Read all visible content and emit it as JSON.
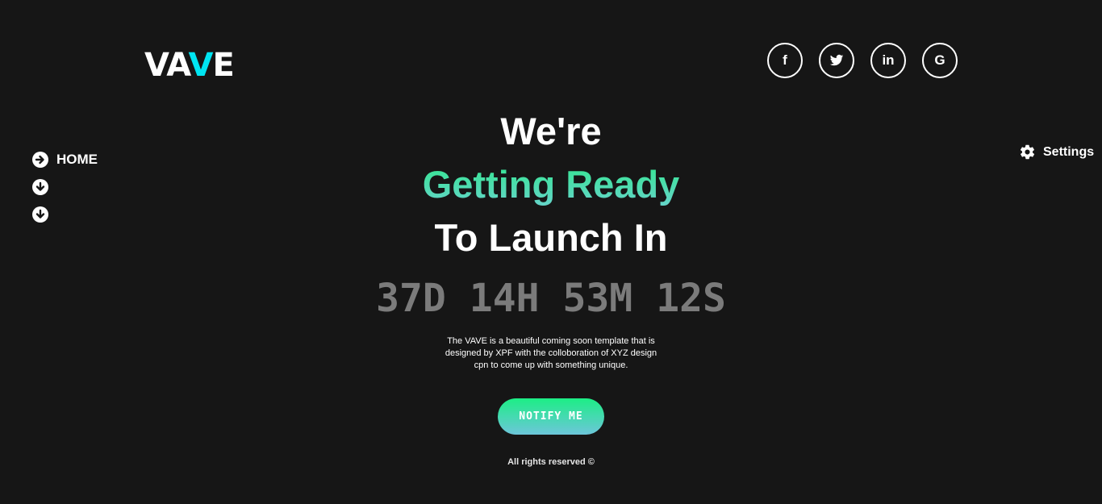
{
  "logo": {
    "part1": "VA",
    "accent": "V",
    "part2": "E",
    "accent_color": "#00e5f2"
  },
  "socials": [
    {
      "name": "facebook",
      "glyph": "f"
    },
    {
      "name": "twitter",
      "glyph": "twitter-bird"
    },
    {
      "name": "linkedin",
      "glyph": "in"
    },
    {
      "name": "google",
      "glyph": "G"
    }
  ],
  "nav": {
    "items": [
      {
        "label": "HOME",
        "icon": "arrow-right-circle-icon"
      },
      {
        "label": "",
        "icon": "arrow-down-circle-icon"
      },
      {
        "label": "",
        "icon": "arrow-down-circle-icon"
      }
    ]
  },
  "settings": {
    "label": "Settings",
    "icon": "gear-icon"
  },
  "hero": {
    "line1": "We're",
    "line2": "Getting Ready",
    "line3": "To Launch In"
  },
  "countdown": {
    "days": "37D",
    "hours": "14H",
    "minutes": "53M",
    "seconds": "12S"
  },
  "description": "The VAVE is a beautiful coming soon template that is designed by XPF with the colloboration of XYZ design cpn to come up with something unique.",
  "notify_label": "NOTIFY ME",
  "footer": "All rights reserved ©",
  "colors": {
    "background": "#161616",
    "accent_green": "#2ee88a",
    "accent_teal": "#6bd2d0",
    "countdown": "#7b7b7b"
  }
}
